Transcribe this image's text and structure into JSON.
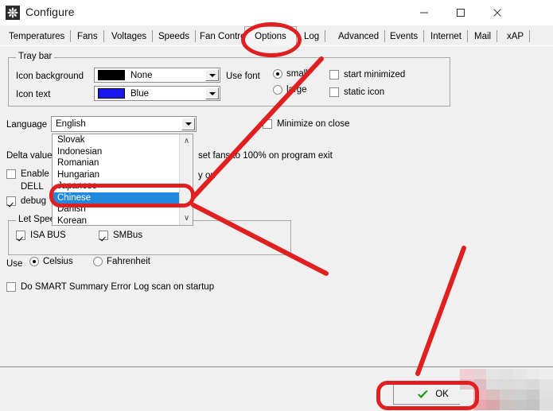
{
  "window": {
    "title": "Configure",
    "icon": "fan-icon",
    "controls": {
      "minimize": "–",
      "maximize": "□",
      "close": "✕"
    }
  },
  "tabs": [
    {
      "label": "Temperatures",
      "active": false
    },
    {
      "label": "Fans",
      "active": false
    },
    {
      "label": "Voltages",
      "active": false
    },
    {
      "label": "Speeds",
      "active": false
    },
    {
      "label": "Fan Control",
      "active": false
    },
    {
      "label": "Options",
      "active": true
    },
    {
      "label": "Log",
      "active": false
    },
    {
      "label": "Advanced",
      "active": false
    },
    {
      "label": "Events",
      "active": false
    },
    {
      "label": "Internet",
      "active": false
    },
    {
      "label": "Mail",
      "active": false
    },
    {
      "label": "xAP",
      "active": false
    }
  ],
  "tray_bar": {
    "group_label": "Tray bar",
    "icon_background": {
      "label": "Icon background",
      "value": "None",
      "color": "#000000"
    },
    "icon_text": {
      "label": "Icon text",
      "value": "Blue",
      "color": "#1a1aee"
    },
    "use_font": {
      "label": "Use font",
      "options": [
        {
          "label": "small",
          "selected": true
        },
        {
          "label": "large",
          "selected": false
        }
      ]
    },
    "start_minimized": {
      "label": "start minimized",
      "checked": false
    },
    "static_icon": {
      "label": "static icon",
      "checked": false
    }
  },
  "options": {
    "language": {
      "label": "Language",
      "value": "English"
    },
    "minimize_on_close": {
      "label": "Minimize on close",
      "checked": false
    },
    "delta_value": {
      "label": "Delta value"
    },
    "set_fans_exit": {
      "label": "set fans to 100% on program exit",
      "checked": false
    },
    "enable_dell": {
      "label": "Enable",
      "label2": "DELL",
      "checked": false
    },
    "partial_right": {
      "label": "y on"
    },
    "debug": {
      "label": "debug",
      "checked": true
    }
  },
  "let_speedfan": {
    "group_label": "Let Spee",
    "isa_bus": {
      "label": "ISA BUS",
      "checked": true
    },
    "smbus": {
      "label": "SMBus",
      "checked": true
    }
  },
  "units": {
    "label": "Use",
    "options": [
      {
        "label": "Celsius",
        "selected": true
      },
      {
        "label": "Fahrenheit",
        "selected": false
      }
    ]
  },
  "smart": {
    "label": "Do SMART Summary Error Log scan on startup",
    "checked": false
  },
  "language_dropdown": {
    "items": [
      {
        "label": "Slovak",
        "selected": false
      },
      {
        "label": "Indonesian",
        "selected": false
      },
      {
        "label": "Romanian",
        "selected": false
      },
      {
        "label": "Hungarian",
        "selected": false
      },
      {
        "label": "Japanese",
        "selected": false
      },
      {
        "label": "Chinese",
        "selected": true
      },
      {
        "label": "Danish",
        "selected": false
      },
      {
        "label": "Korean",
        "selected": false
      }
    ],
    "scroll_up": "∧",
    "scroll_down": "∨"
  },
  "footer": {
    "ok_label": "OK",
    "ok_icon": "green-check-icon"
  },
  "annotation": {
    "color": "#e02020"
  }
}
